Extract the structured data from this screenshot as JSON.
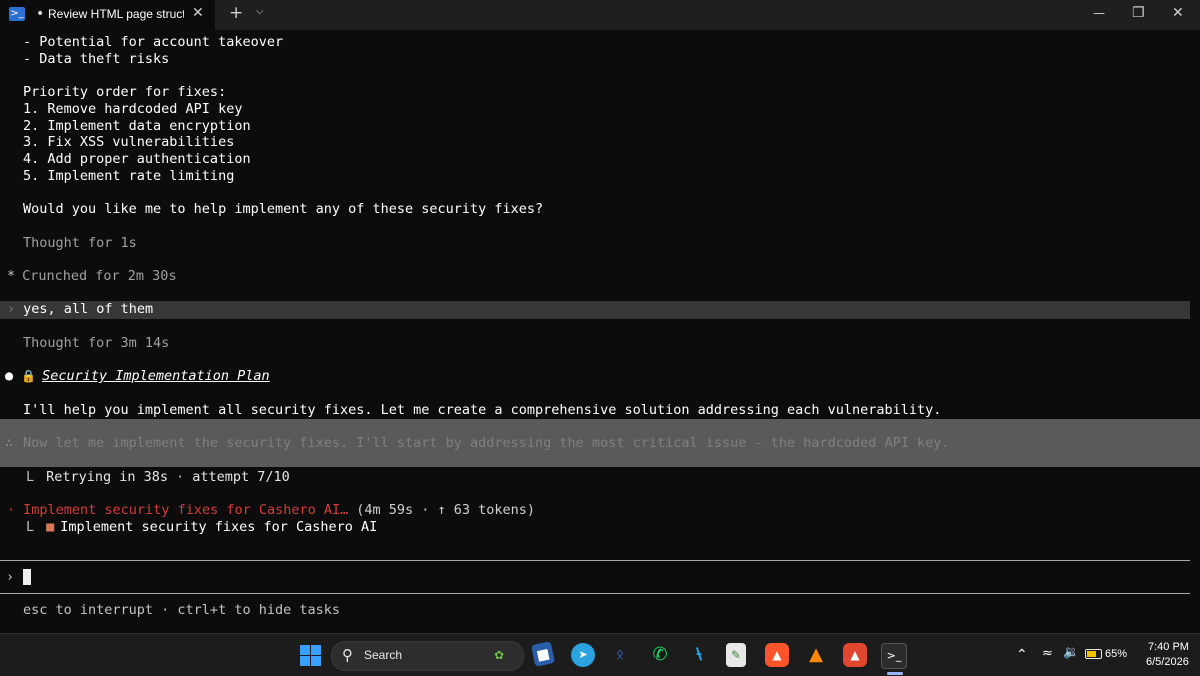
{
  "titlebar": {
    "tab_title": "Review HTML page structur",
    "tab_dot": "•",
    "close_glyph": "✕",
    "new_tab_glyph": "+",
    "dropdown_glyph": "⌄",
    "minimize_glyph": "—",
    "maximize_glyph": "❐",
    "window_close_glyph": "✕"
  },
  "terminal": {
    "risk_lines": [
      "- Potential for account takeover",
      "- Data theft risks"
    ],
    "priority_heading": "Priority order for fixes:",
    "priority_items": [
      "1. Remove hardcoded API key",
      "2. Implement data encryption",
      "3. Fix XSS vulnerabilities",
      "4. Add proper authentication",
      "5. Implement rate limiting"
    ],
    "question": "Would you like me to help implement any of these security fixes?",
    "thought_1": "Thought for 1s",
    "crunched_glyph": "*",
    "crunched": "Crunched for 2m 30s",
    "user_prompt_glyph": "›",
    "user_message": "yes, all of them",
    "thought_2": "Thought for 3m 14s",
    "plan_bullet": "●",
    "plan_emoji": "🔒",
    "plan_title": "Security Implementation Plan",
    "plan_intro": "I'll help you implement all security fixes. Let me create a comprehensive solution addressing each vulnerability.",
    "faded_prefix": "∴",
    "faded_line": "Now let me implement the security fixes. I'll start by addressing the most critical issue - the hardcoded API key.",
    "retry_branch": "L",
    "retry_text": "Retrying in 38s",
    "retry_sep": "·",
    "retry_attempt": "attempt 7/10",
    "task_prefix": "·",
    "task_active": "Implement security fixes for Cashero AI…",
    "task_meta": "(4m 59s · ↑ 63 tokens)",
    "subtask_branch": "L",
    "subtask_square": "■",
    "subtask_label": "Implement security fixes for Cashero AI",
    "input_prompt": "›",
    "hint": "esc to interrupt · ctrl+t to hide tasks"
  },
  "taskbar": {
    "search_label": "Search",
    "search_glyph": "⚲",
    "tray_chevron": "⌃",
    "battery_percent": "65%",
    "time": "7:40 PM",
    "date": "6/5/2026",
    "icons": [
      "start-icon",
      "file-explorer-icon",
      "telegram-icon",
      "bluetooth-icon",
      "whatsapp-icon",
      "vscode-icon",
      "notepad-icon",
      "brave-icon",
      "vlc-icon",
      "brave-nightly-icon",
      "terminal-icon"
    ]
  },
  "colors": {
    "terminal_bg": "#0c0c0c",
    "highlight_user": "#373737",
    "highlight_band": "#5a5a5a",
    "task_red": "#d43b3b",
    "subtask_orange": "#d97757"
  }
}
